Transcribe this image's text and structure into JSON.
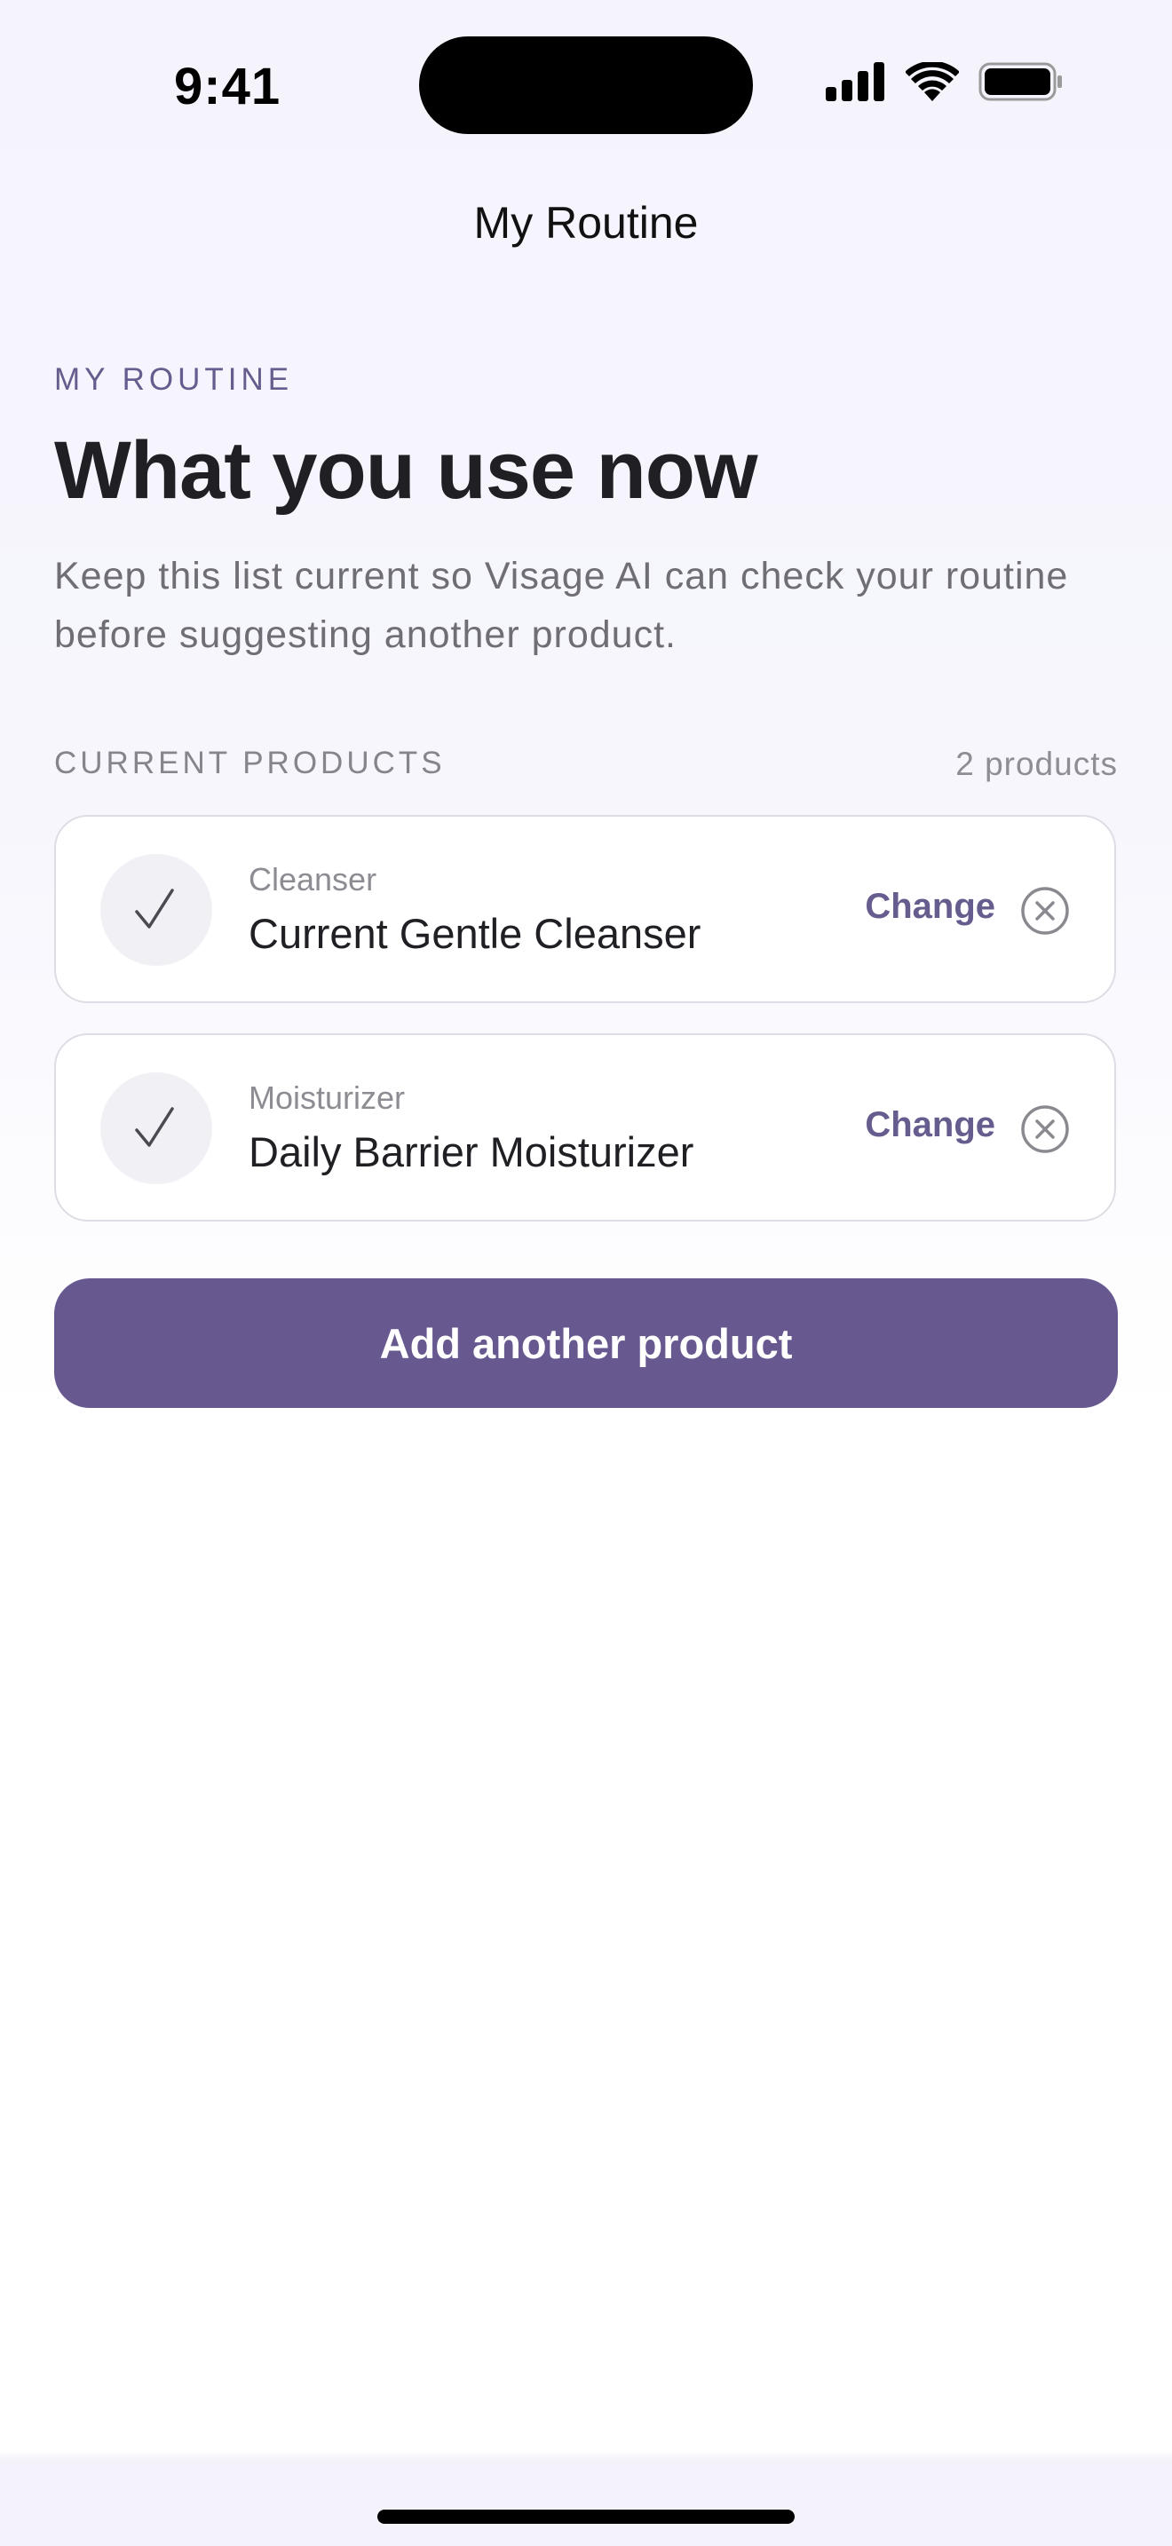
{
  "status_bar": {
    "time": "9:41"
  },
  "nav": {
    "title": "My Routine"
  },
  "header": {
    "eyebrow": "MY ROUTINE",
    "title": "What you use now",
    "description": "Keep this list current so Visage AI can check your routine before suggesting another product."
  },
  "section": {
    "label": "CURRENT PRODUCTS",
    "count": "2 products"
  },
  "products": [
    {
      "category": "Cleanser",
      "name": "Current Gentle Cleanser",
      "change_label": "Change",
      "status_icon": "checkmark-icon",
      "remove_icon": "remove-circle-x-icon"
    },
    {
      "category": "Moisturizer",
      "name": "Daily Barrier Moisturizer",
      "change_label": "Change",
      "status_icon": "checkmark-icon",
      "remove_icon": "remove-circle-x-icon"
    }
  ],
  "actions": {
    "add_label": "Add another product"
  },
  "colors": {
    "accent": "#685890",
    "accent_text": "#665c8e",
    "background_top": "#f5f4fd",
    "card_border": "#dedde5"
  }
}
